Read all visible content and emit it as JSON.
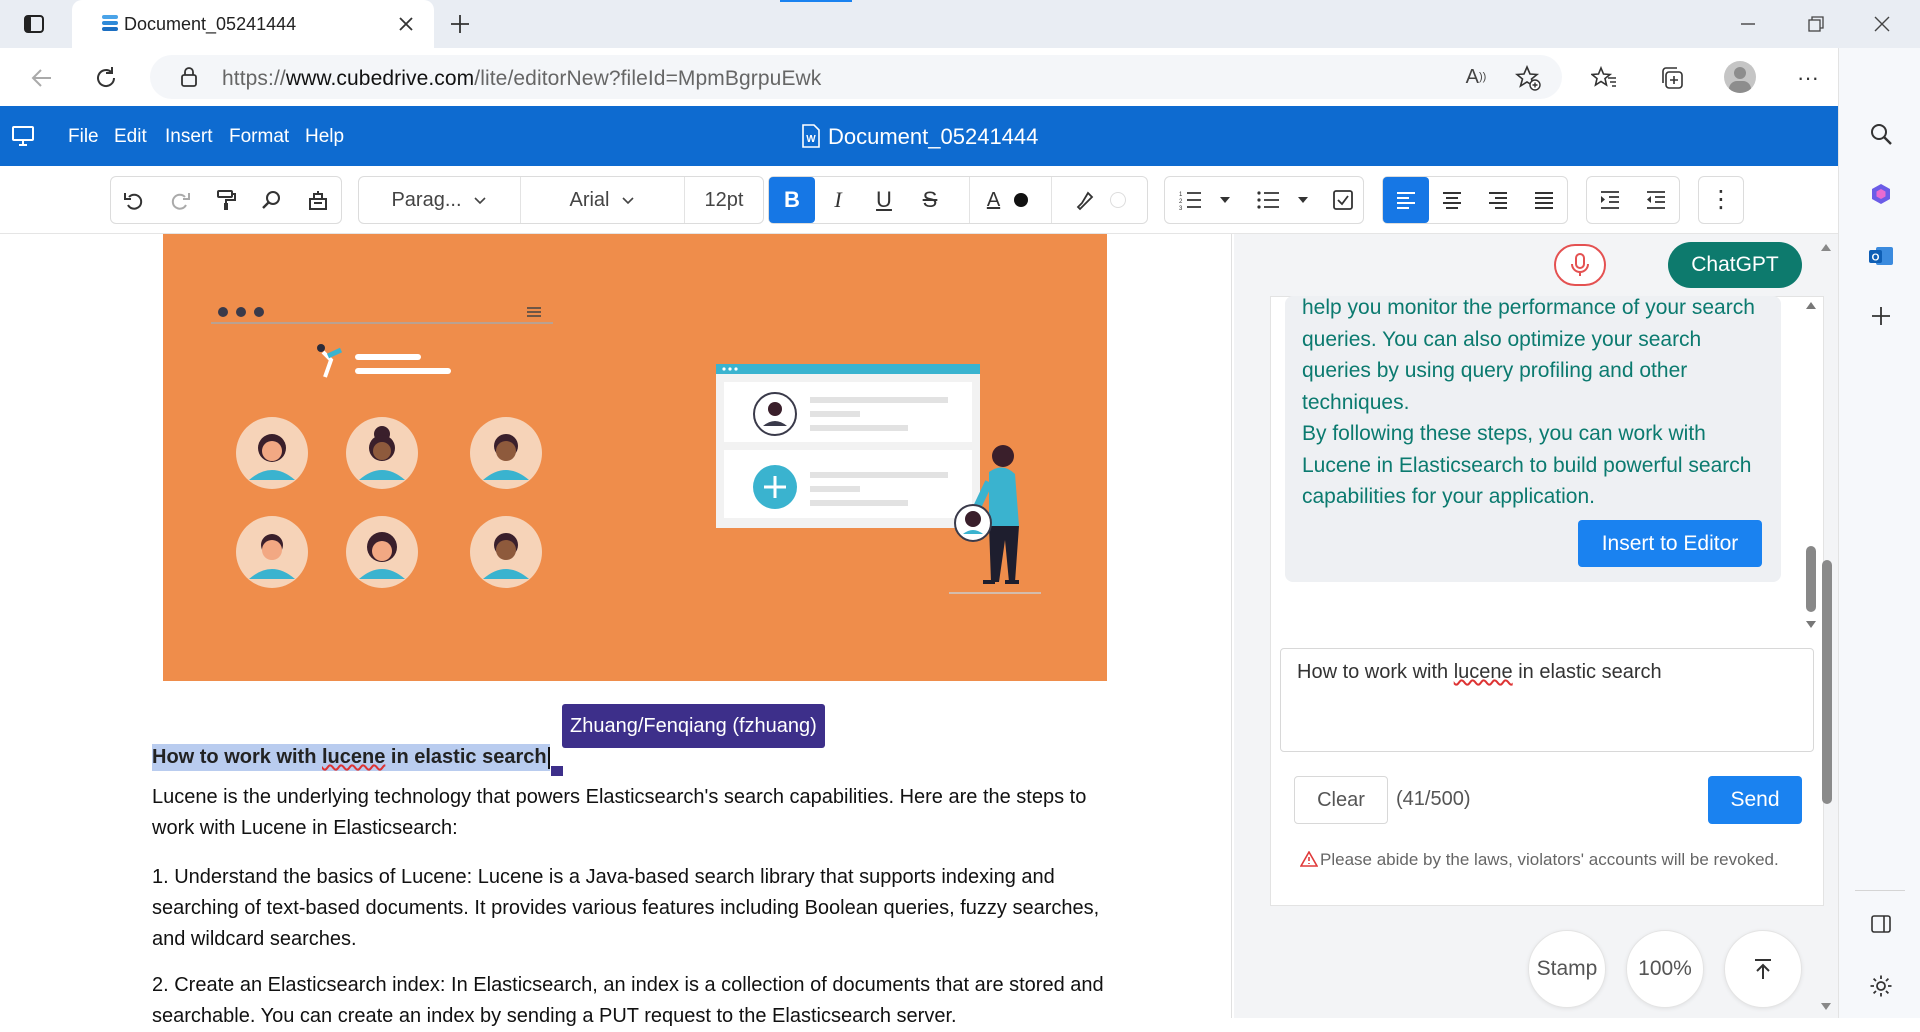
{
  "browser": {
    "tab_title": "Document_05241444",
    "url_prefix": "https://",
    "url_domain": "www.cubedrive.com",
    "url_path": "/lite/editorNew?fileId=MpmBgrpuEwk"
  },
  "app": {
    "menu": [
      "File",
      "Edit",
      "Insert",
      "Format",
      "Help"
    ],
    "doc_title": "Document_05241444",
    "brand_color": "#0e6bd0"
  },
  "toolbar": {
    "paragraph": "Parag...",
    "font": "Arial",
    "size": "12pt"
  },
  "document": {
    "collaborator": "Zhuang/Fenqiang (fzhuang)",
    "heading_pre": "How to work with ",
    "heading_word": "lucene",
    "heading_post": " in elastic search",
    "para1": "Lucene is the underlying technology that powers Elasticsearch's search capabilities. Here are the steps to work with Lucene in Elasticsearch:",
    "para2": "1. Understand the basics of Lucene: Lucene is a Java-based search library that supports indexing and searching of text-based documents. It provides various features including Boolean queries, fuzzy searches, and wildcard searches.",
    "para3": "2. Create an Elasticsearch index: In Elasticsearch, an index is a collection of documents that are stored and searchable. You can create an index by sending a PUT request to the Elasticsearch server."
  },
  "chat": {
    "chatgpt_label": "ChatGPT",
    "bubble_p1": "help you monitor the performance of your search queries. You can also optimize your search queries by using query profiling and other techniques.",
    "bubble_p2": "By following these steps, you can work with Lucene in Elasticsearch to build powerful search capabilities for your application.",
    "insert_label": "Insert to Editor",
    "input_pre": "How to work with ",
    "input_word": "lucene",
    "input_post": " in elastic search",
    "clear_label": "Clear",
    "count": "(41/500)",
    "send_label": "Send",
    "warning": "Please abide by the laws, violators' accounts will be revoked."
  },
  "footer": {
    "stamp": "Stamp",
    "zoom": "100%"
  }
}
